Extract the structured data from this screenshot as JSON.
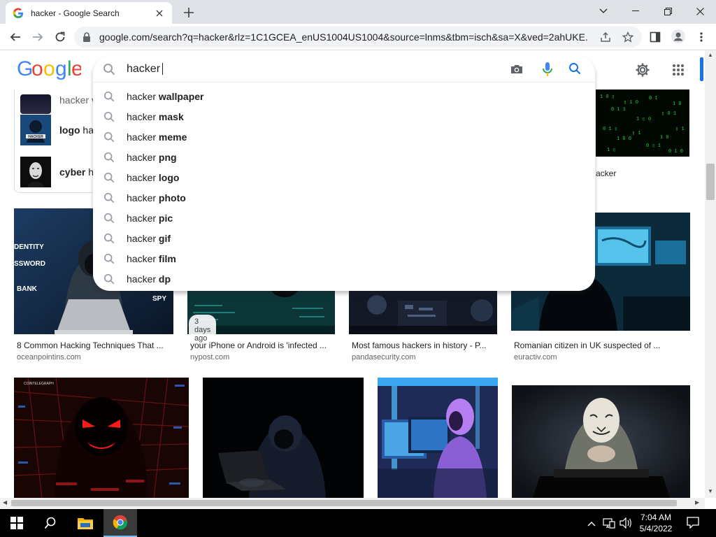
{
  "browser": {
    "tab_title": "hacker - Google Search",
    "tab_favicon": "G",
    "url": "google.com/search?q=hacker&rlz=1C1GCEA_enUS1004US1004&source=lnms&tbm=isch&sa=X&ved=2ahUKE..."
  },
  "search": {
    "value": "hacker",
    "suggestions": [
      {
        "prefix": "hacker ",
        "bold": "wallpaper"
      },
      {
        "prefix": "hacker ",
        "bold": "mask"
      },
      {
        "prefix": "hacker ",
        "bold": "meme"
      },
      {
        "prefix": "hacker ",
        "bold": "png"
      },
      {
        "prefix": "hacker ",
        "bold": "logo"
      },
      {
        "prefix": "hacker ",
        "bold": "photo"
      },
      {
        "prefix": "hacker ",
        "bold": "pic"
      },
      {
        "prefix": "hacker ",
        "bold": "gif"
      },
      {
        "prefix": "hacker ",
        "bold": "film"
      },
      {
        "prefix": "hacker ",
        "bold": "dp"
      }
    ]
  },
  "related": [
    {
      "bold": "hacker",
      "rest": " v"
    },
    {
      "bold": "logo",
      "rest": " ha"
    },
    {
      "bold": "cyber",
      "rest": " h"
    }
  ],
  "results": {
    "partial_caption": "acker",
    "row1": [
      {
        "caption": "8 Common Hacking Techniques That ...",
        "source": "oceanpointins.com"
      },
      {
        "caption": "your iPhone or Android is 'infected ...",
        "source": "nypost.com",
        "badge": "3 days ago"
      },
      {
        "caption": "Most famous hackers in history - P...",
        "source": "pandasecurity.com"
      },
      {
        "caption": "Romanian citizen in UK suspected of ...",
        "source": "euractiv.com"
      }
    ],
    "image_text": {
      "identity": "DENTITY",
      "password": "SSWORD",
      "bank": "BANK",
      "spy": "SPY",
      "cointelegraph": "COINTELEGRAPH"
    }
  },
  "taskbar": {
    "time": "7:04 AM",
    "date": "5/4/2022"
  },
  "colors": {
    "google_blue": "#4285f4",
    "google_red": "#ea4335",
    "google_yellow": "#fbbc05",
    "google_green": "#34a853",
    "accent": "#1a73e8"
  }
}
